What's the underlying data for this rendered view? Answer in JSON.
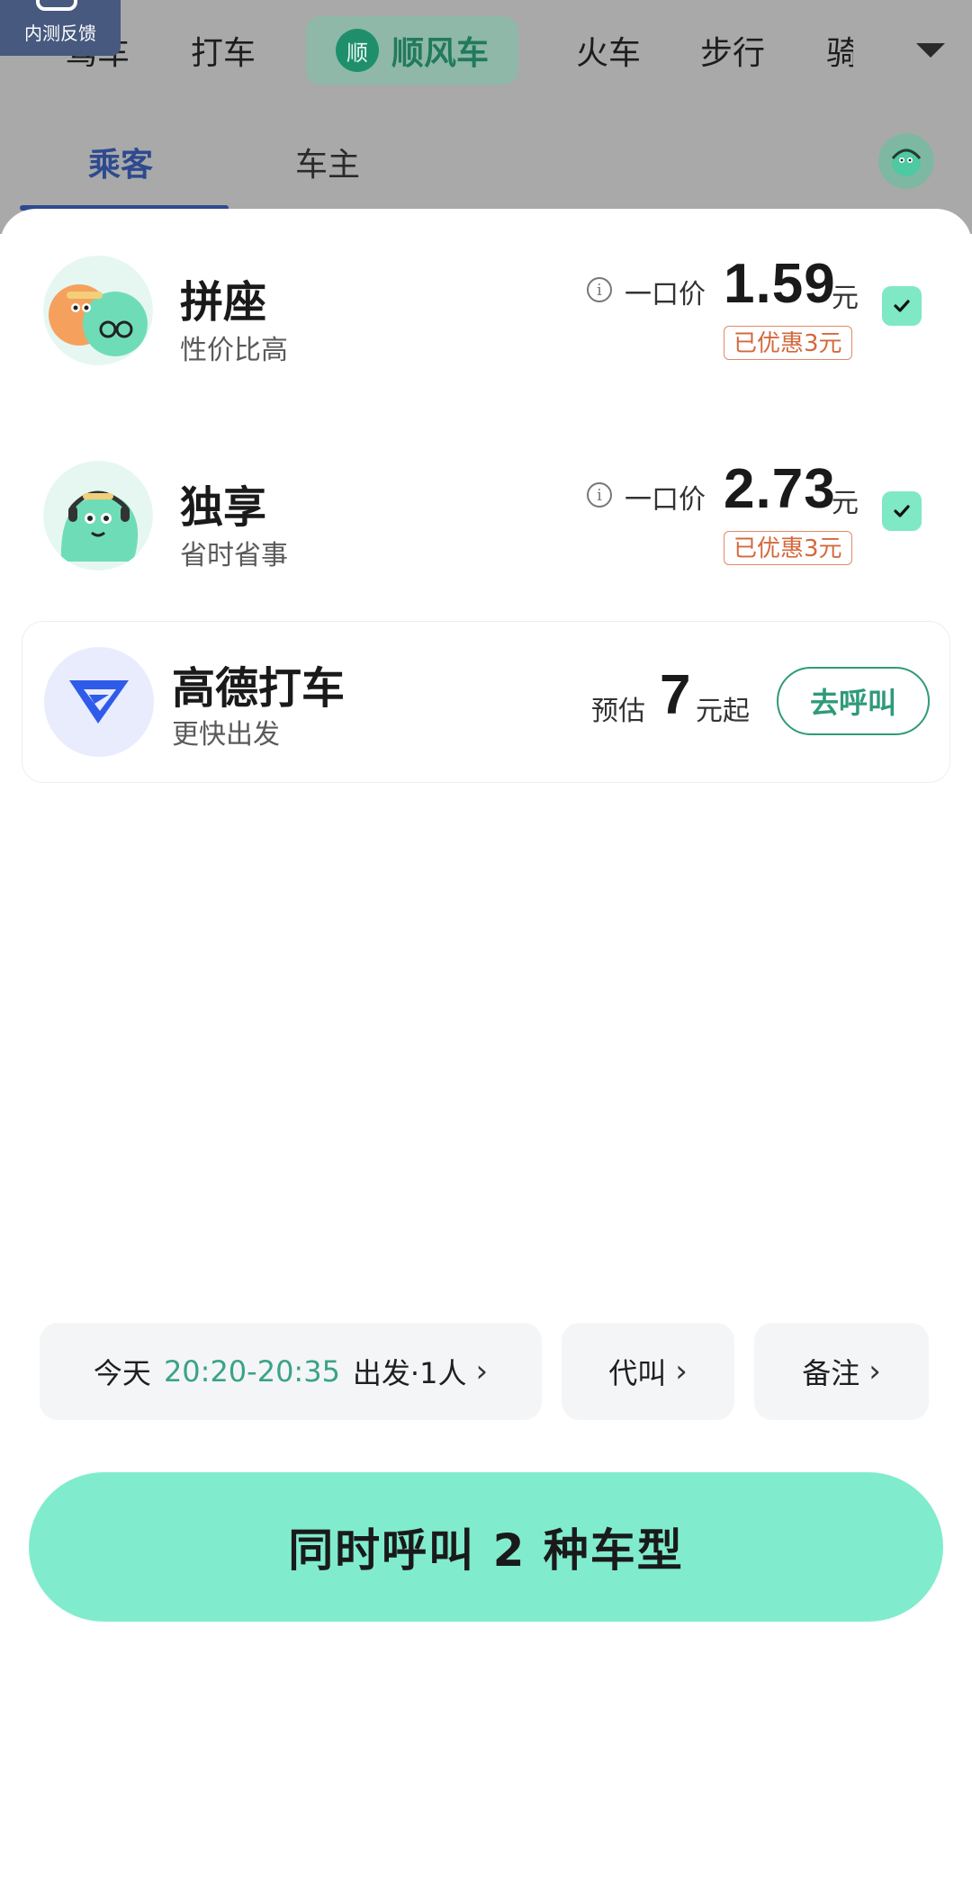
{
  "feedback": {
    "label": "内测反馈"
  },
  "topnav": {
    "items": [
      "驾车",
      "打车",
      "火车",
      "步行",
      "骑"
    ],
    "active": {
      "badge": "顺",
      "label": "顺风车"
    }
  },
  "subtabs": {
    "passenger": "乘客",
    "driver": "车主"
  },
  "rides": [
    {
      "title": "拼座",
      "subtitle": "性价比高",
      "price_label": "一口价",
      "price": "1.59",
      "unit": "元",
      "discount": "已优惠3元",
      "checked": true
    },
    {
      "title": "独享",
      "subtitle": "省时省事",
      "price_label": "一口价",
      "price": "2.73",
      "unit": "元",
      "discount": "已优惠3元",
      "checked": true
    }
  ],
  "gaode": {
    "title": "高德打车",
    "subtitle": "更快出发",
    "est_label": "预估",
    "est_value": "7",
    "est_unit": "元起",
    "button": "去呼叫"
  },
  "options": {
    "time_prefix": "今天",
    "time_range": "20:20-20:35",
    "time_suffix": "出发·1人",
    "proxy": "代叫",
    "note": "备注"
  },
  "cta": {
    "label": "同时呼叫 2 种车型"
  },
  "colors": {
    "accent": "#80eccd",
    "accent_dark": "#2f9a7a",
    "discount": "#d4683e",
    "tab_active": "#2e4a8f"
  }
}
